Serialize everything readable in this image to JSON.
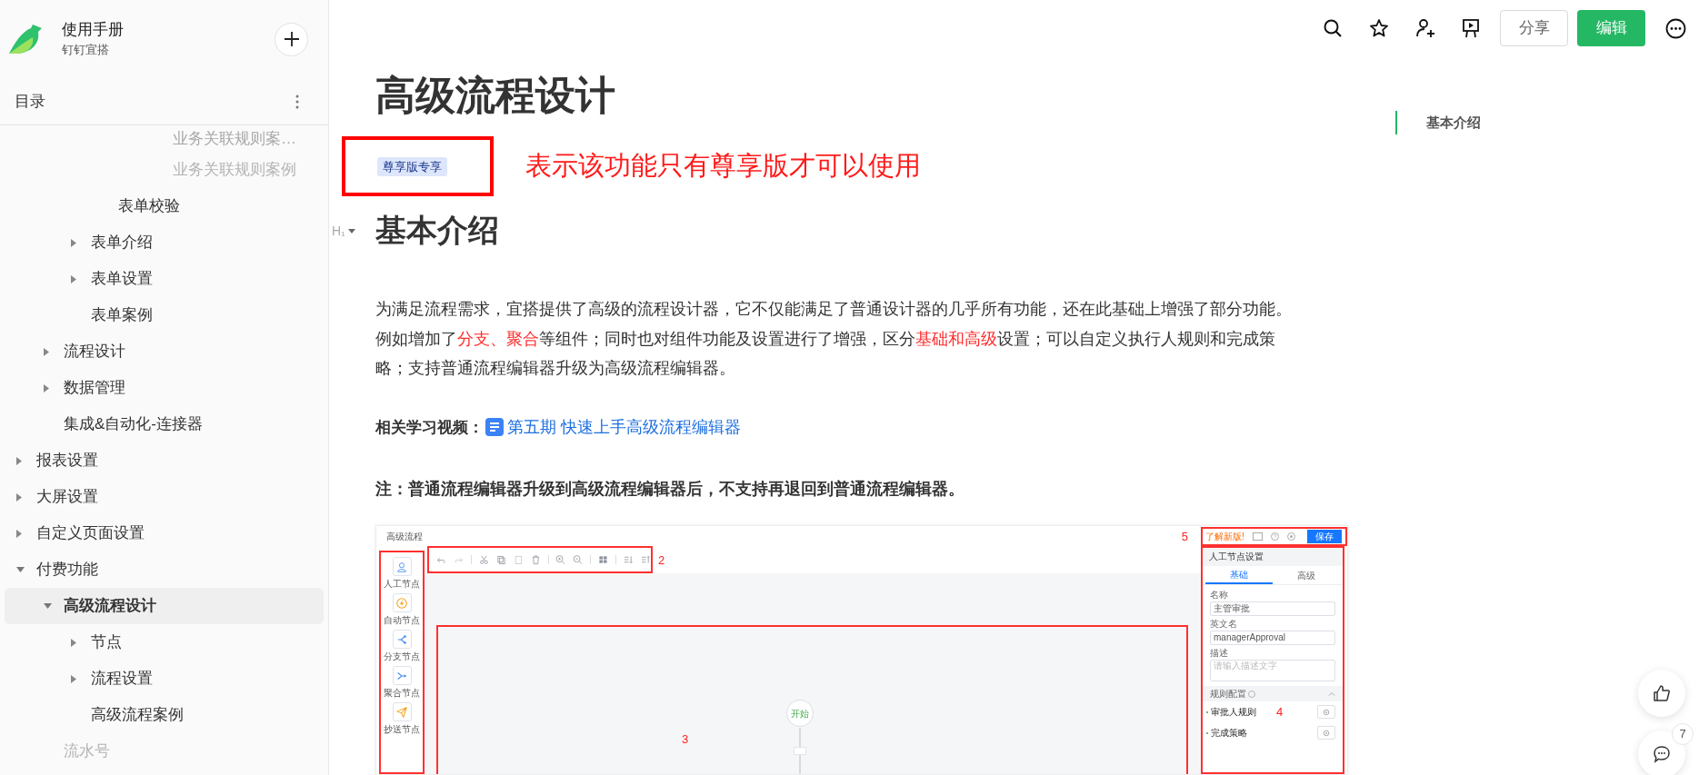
{
  "sidebar": {
    "title": "使用手册",
    "subtitle": "钉钉宜搭",
    "toc_label": "目录",
    "tree": [
      {
        "children": [
          {
            "children": [
              {
                "children": [
                  {
                    "children": [
                      {
                        "children": [
                          {
                            "label": "业务关联规则案…",
                            "selected": false
                          },
                          {
                            "label": "业务关联规则案例",
                            "selected": false
                          }
                        ]
                      }
                    ]
                  },
                  {
                    "label": "表单校验",
                    "selected": false
                  }
                ]
              },
              {
                "label": "表单介绍",
                "expanded": false,
                "selected": false
              },
              {
                "label": "表单设置",
                "expanded": false,
                "selected": false
              },
              {
                "label": "表单案例",
                "selected": false
              }
            ]
          },
          {
            "label": "流程设计",
            "expanded": false,
            "selected": false
          },
          {
            "label": "数据管理",
            "expanded": false,
            "selected": false
          },
          {
            "label": "集成&自动化-连接器",
            "selected": false
          }
        ]
      },
      {
        "label": "报表设置",
        "expanded": false,
        "selected": false
      },
      {
        "label": "大屏设置",
        "expanded": false,
        "selected": false
      },
      {
        "label": "自定义页面设置",
        "expanded": false,
        "selected": false
      },
      {
        "label": "付费功能",
        "expanded": true,
        "selected": false,
        "children": [
          {
            "label": "高级流程设计",
            "expanded": true,
            "selected": true,
            "children": [
              {
                "label": "节点",
                "expanded": false,
                "selected": false
              },
              {
                "label": "流程设置",
                "expanded": false,
                "selected": false
              },
              {
                "label": "高级流程案例",
                "selected": false
              }
            ]
          },
          {
            "label": "流水号",
            "selected": false
          }
        ]
      }
    ]
  },
  "toolbar": {
    "share": "分享",
    "edit": "编辑"
  },
  "article": {
    "title": "高级流程设计",
    "badge": "尊享版专享",
    "annotation": "表示该功能只有尊享版才可以使用",
    "heading_marker": "H₁",
    "heading": "基本介绍",
    "paragraph": [
      {
        "text": "为满足流程需求，宜搭提供了高级的流程设计器，它不仅能满足了普通设计器的几乎所有功能，还在此基础上增强了部分功能。例如增加了",
        "highlight": false
      },
      {
        "text": "分支、聚合",
        "highlight": true
      },
      {
        "text": "等组件；同时也对组件功能及设置进行了增强，区分",
        "highlight": false
      },
      {
        "text": "基础和高级",
        "highlight": true
      },
      {
        "text": "设置；可以自定义执行人规则和完成策略；支持普通流程编辑器升级为高级流程编辑器。",
        "highlight": false
      }
    ],
    "related_label": "相关学习视频：",
    "related_link": "第五期 快速上手高级流程编辑器",
    "note": "注：普通流程编辑器升级到高级流程编辑器后，不支持再退回到普通流程编辑器。",
    "embedded_screenshot": {
      "title": "高级流程",
      "header_mark": "5",
      "whats_new": "了解新版!",
      "save": "保存",
      "toolbar_mark": "2",
      "canvas_mark": "3",
      "start_node": "开始",
      "palette": [
        {
          "label": "人工节点",
          "kind": "person"
        },
        {
          "label": "自动节点",
          "kind": "bolt"
        },
        {
          "label": "分支节点",
          "kind": "branch"
        },
        {
          "label": "聚合节点",
          "kind": "merge"
        },
        {
          "label": "抄送节点",
          "kind": "send"
        }
      ],
      "panel": {
        "title": "人工节点设置",
        "tabs": [
          {
            "label": "基础",
            "selected": true
          },
          {
            "label": "高级",
            "selected": false
          }
        ],
        "fields": [
          {
            "label": "名称",
            "kind": "input",
            "value": "主管审批"
          },
          {
            "label": "英文名",
            "kind": "input",
            "value": "managerApproval"
          },
          {
            "label": "描述",
            "kind": "textarea",
            "placeholder": "请输入描述文字"
          }
        ],
        "section": "规则配置",
        "rules": [
          "审批人规则",
          "完成策略"
        ],
        "panel_mark": "4"
      }
    }
  },
  "outline": {
    "items": [
      {
        "label": "基本介绍",
        "selected": true
      }
    ]
  },
  "floating": {
    "comment_count": "7"
  }
}
